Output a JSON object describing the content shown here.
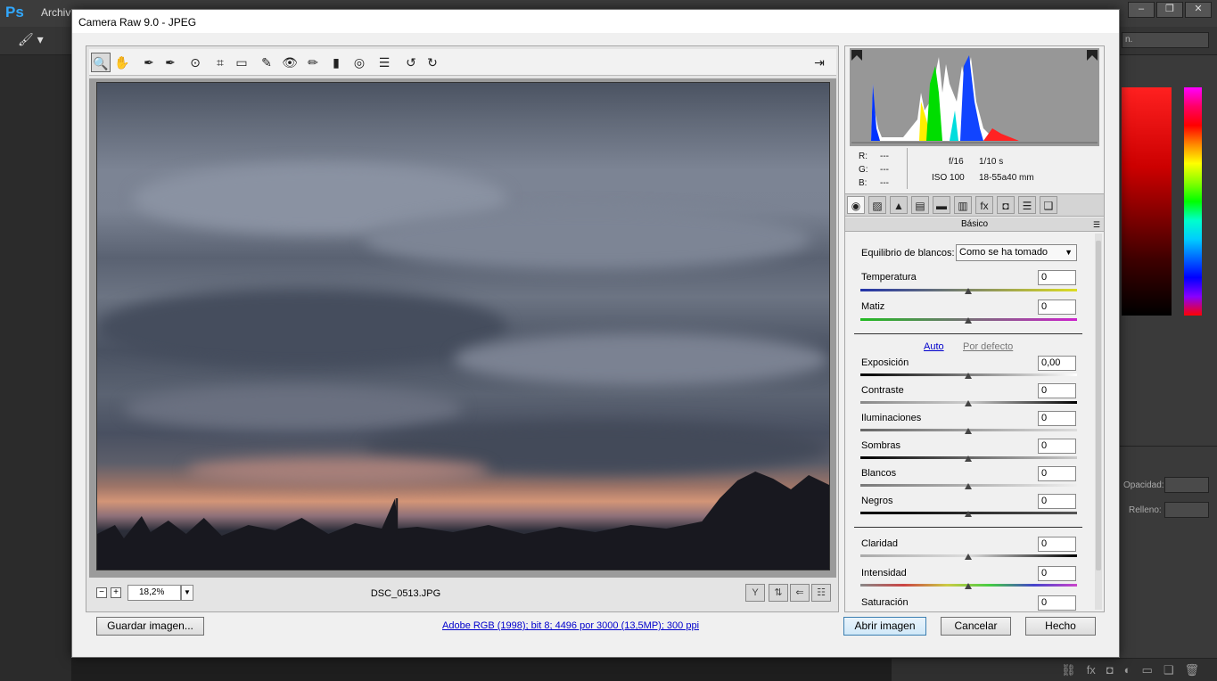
{
  "ps": {
    "logo": "Ps",
    "menu_first": "Archiv",
    "window_controls": [
      "–",
      "❐",
      "✕"
    ],
    "right_select": "n.",
    "opacity_label": "Opacidad:",
    "fill_label": "Relleno:"
  },
  "dialog": {
    "title": "Camera Raw 9.0 -  JPEG"
  },
  "toolbar": {
    "tools": [
      {
        "name": "zoom-tool",
        "glyph": "🔍"
      },
      {
        "name": "hand-tool",
        "glyph": "✋"
      },
      {
        "name": "white-balance-tool",
        "glyph": "✒"
      },
      {
        "name": "color-sampler-tool",
        "glyph": "✒"
      },
      {
        "name": "targeted-adjustment-tool",
        "glyph": "⊙"
      },
      {
        "name": "crop-tool",
        "glyph": "⌗"
      },
      {
        "name": "straighten-tool",
        "glyph": "▭"
      },
      {
        "name": "spot-removal-tool",
        "glyph": "✎"
      },
      {
        "name": "red-eye-tool",
        "glyph": "👁"
      },
      {
        "name": "adjustment-brush-tool",
        "glyph": "✏"
      },
      {
        "name": "graduated-filter-tool",
        "glyph": "▮"
      },
      {
        "name": "radial-filter-tool",
        "glyph": "◎"
      },
      {
        "name": "preferences-tool",
        "glyph": "☰"
      },
      {
        "name": "rotate-left-tool",
        "glyph": "↺"
      },
      {
        "name": "rotate-right-tool",
        "glyph": "↻"
      }
    ],
    "fullscreen_glyph": "⇥"
  },
  "preview": {
    "zoom_value": "18,2%",
    "filename": "DSC_0513.JPG",
    "zoom_out": "−",
    "zoom_in": "+"
  },
  "info": {
    "r_label": "R:",
    "r_value": "---",
    "g_label": "G:",
    "g_value": "---",
    "b_label": "B:",
    "b_value": "---",
    "aperture": "f/16",
    "shutter": "1/10 s",
    "iso": "ISO 100",
    "lens": "18-55a40 mm"
  },
  "panel": {
    "title": "Básico",
    "wb_label": "Equilibrio de blancos:",
    "wb_value": "Como se ha tomado",
    "auto": "Auto",
    "default": "Por defecto",
    "sliders": [
      {
        "label": "Temperatura",
        "value": "0"
      },
      {
        "label": "Matiz",
        "value": "0"
      },
      {
        "label": "Exposición",
        "value": "0,00"
      },
      {
        "label": "Contraste",
        "value": "0"
      },
      {
        "label": "Iluminaciones",
        "value": "0"
      },
      {
        "label": "Sombras",
        "value": "0"
      },
      {
        "label": "Blancos",
        "value": "0"
      },
      {
        "label": "Negros",
        "value": "0"
      },
      {
        "label": "Claridad",
        "value": "0"
      },
      {
        "label": "Intensidad",
        "value": "0"
      },
      {
        "label": "Saturación",
        "value": "0"
      }
    ]
  },
  "footer": {
    "save_label": "Guardar imagen...",
    "meta_link": "Adobe RGB (1998); bit 8; 4496 por 3000 (13,5MP); 300 ppi",
    "open_label": "Abrir imagen",
    "cancel_label": "Cancelar",
    "done_label": "Hecho"
  }
}
